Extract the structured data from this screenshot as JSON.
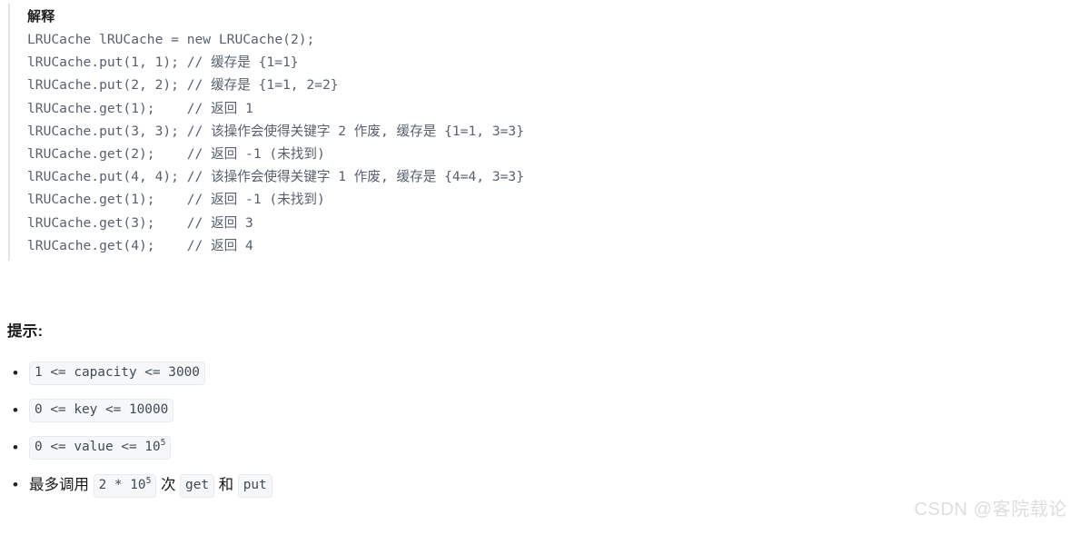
{
  "explanation": {
    "title": "解释",
    "lines": [
      "LRUCache lRUCache = new LRUCache(2);",
      "lRUCache.put(1, 1); // 缓存是 {1=1}",
      "lRUCache.put(2, 2); // 缓存是 {1=1, 2=2}",
      "lRUCache.get(1);    // 返回 1",
      "lRUCache.put(3, 3); // 该操作会使得关键字 2 作废, 缓存是 {1=1, 3=3}",
      "lRUCache.get(2);    // 返回 -1 (未找到)",
      "lRUCache.put(4, 4); // 该操作会使得关键字 1 作废, 缓存是 {4=4, 3=3}",
      "lRUCache.get(1);    // 返回 -1 (未找到)",
      "lRUCache.get(3);    // 返回 3",
      "lRUCache.get(4);    // 返回 4"
    ]
  },
  "hints": {
    "heading": "提示:",
    "bullet_glyph": "•",
    "items": [
      {
        "parts": [
          {
            "kind": "code",
            "text": "1 <= capacity <= 3000"
          }
        ]
      },
      {
        "parts": [
          {
            "kind": "code",
            "text": "0 <= key <= 10000"
          }
        ]
      },
      {
        "parts": [
          {
            "kind": "code",
            "text": "0 <= value <= 10",
            "sup": "5"
          }
        ]
      },
      {
        "parts": [
          {
            "kind": "text",
            "text": "最多调用 "
          },
          {
            "kind": "code",
            "text": "2 * 10",
            "sup": "5"
          },
          {
            "kind": "text",
            "text": " 次 "
          },
          {
            "kind": "code",
            "text": "get"
          },
          {
            "kind": "text",
            "text": " 和 "
          },
          {
            "kind": "code",
            "text": "put"
          }
        ]
      }
    ]
  },
  "watermark": {
    "text": "CSDN @客院载论"
  },
  "colors": {
    "page_background": "#ffffff",
    "code_text": "#58606c",
    "code_border": "#e3e5e8",
    "inline_code_background": "#f6f7f8",
    "inline_code_border": "#e9eaec",
    "body_text": "#1f2328",
    "watermark": "#dddee0"
  }
}
